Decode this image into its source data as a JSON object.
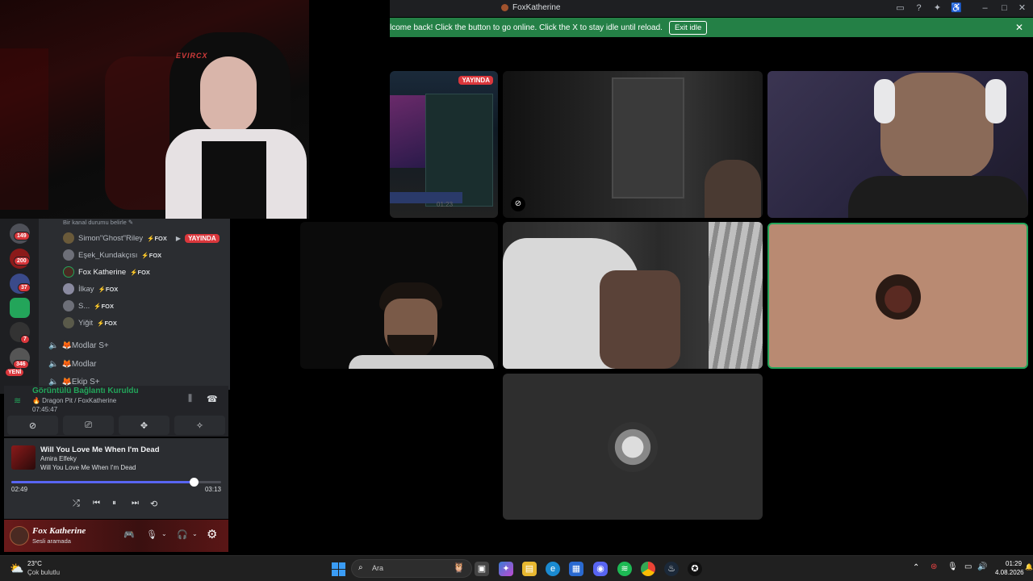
{
  "window": {
    "title": "FoxKatherine",
    "controls": {
      "minimize": "–",
      "maximize": "□",
      "close": "✕"
    }
  },
  "banner": {
    "message": "lcome back! Click the button to go online. Click the X to stay idle until reload.",
    "button": "Exit idle",
    "close": "✕"
  },
  "tiles": {
    "stream_badge": "YAYINDA",
    "stream_time": "01:23"
  },
  "servers": [
    {
      "badge": "149",
      "color": "#4e5058"
    },
    {
      "badge": "200",
      "color": "#8b1a1a"
    },
    {
      "badge": "37",
      "color": "#3a4a8a"
    },
    {
      "badge": "",
      "color": "#23a55a"
    },
    {
      "badge": "7",
      "color": "#333"
    },
    {
      "badge": "346",
      "color": "#555"
    }
  ],
  "server_new_label": "YENİ",
  "channel": {
    "status_hint": "Bir kanal durumu belirle",
    "members": [
      {
        "name": "Simon\"Ghost\"Riley",
        "tag": "⚡FOX",
        "live": "YAYINDA"
      },
      {
        "name": "Eşek_Kundakçısı",
        "tag": "⚡FOX"
      },
      {
        "name": "Fox Katherine",
        "tag": "⚡FOX"
      },
      {
        "name": "İlkay",
        "tag": "⚡FOX"
      },
      {
        "name": "S...",
        "tag": "⚡FOX"
      },
      {
        "name": "Yiğit",
        "tag": "⚡FOX"
      }
    ],
    "voice_channels": [
      {
        "name": "🦊Modlar S+"
      },
      {
        "name": "🦊Modlar"
      },
      {
        "name": "🦊Ekip S+"
      }
    ]
  },
  "voice": {
    "status": "Görüntülü Bağlantı Kuruldu",
    "location": "🔥 Dragon Pit / FoxKatherine",
    "timer": "07:45:47"
  },
  "music": {
    "title": "Will You Love Me When I'm Dead",
    "artist": "Amira Elfeky",
    "album": "Will You Love Me When I'm Dead",
    "elapsed": "02:49",
    "duration": "03:13",
    "progress": 0.87
  },
  "user": {
    "name": "Fox Katherine",
    "status": "Sesli aramada"
  },
  "taskbar": {
    "weather_temp": "23°C",
    "weather_desc": "Çok bulutlu",
    "search_placeholder": "Ara",
    "time": "01:29",
    "date": "4.08.2026"
  }
}
